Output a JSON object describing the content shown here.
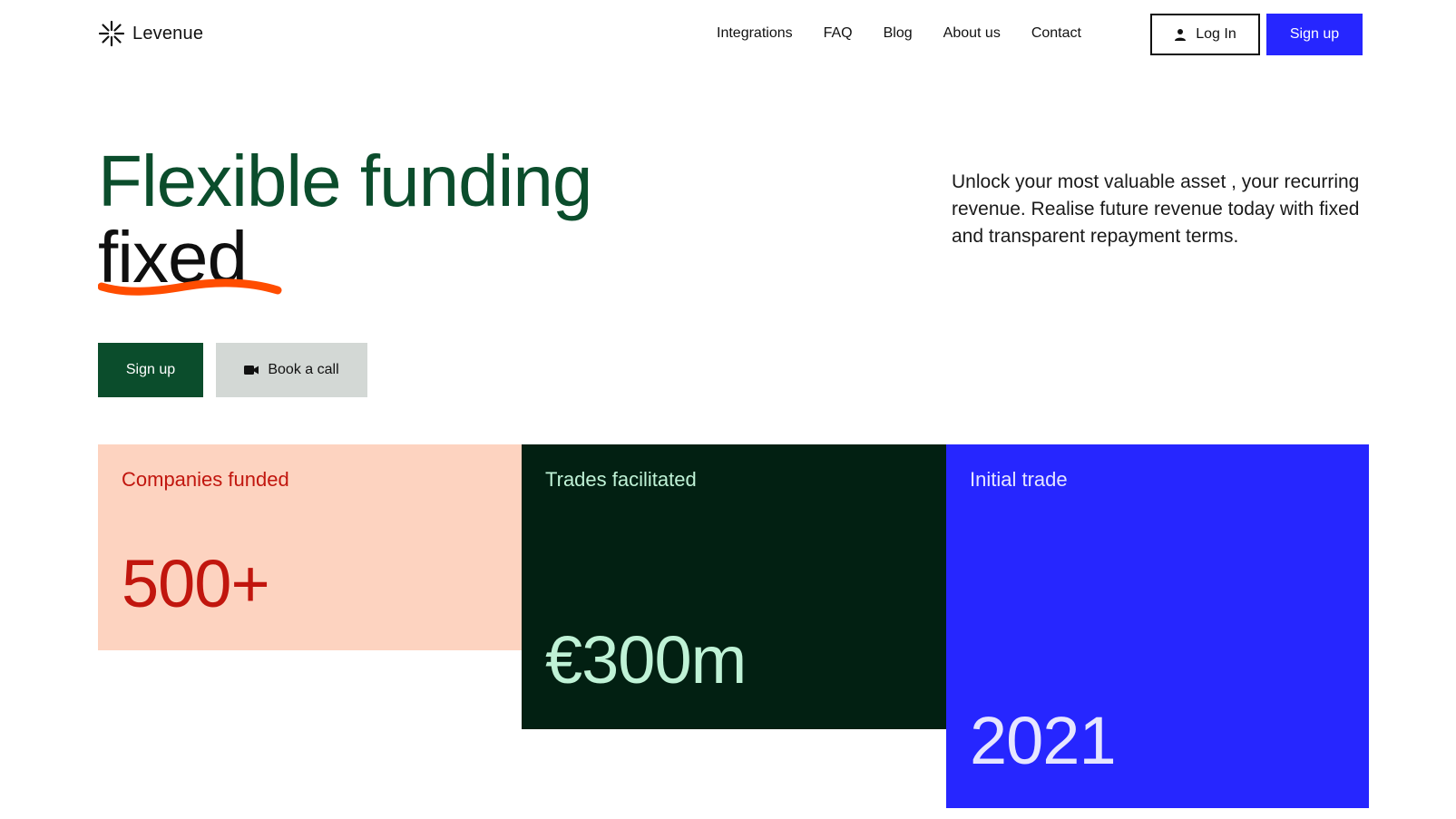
{
  "header": {
    "logo_text": "Levenue",
    "nav": [
      {
        "label": "Integrations"
      },
      {
        "label": "FAQ"
      },
      {
        "label": "Blog"
      },
      {
        "label": "About us"
      },
      {
        "label": "Contact"
      }
    ],
    "login_label": "Log In",
    "signup_label": "Sign up"
  },
  "hero": {
    "title_line1": "Flexible funding",
    "title_line2": "fixed",
    "description": "Unlock your most valuable asset , your recurring revenue. Realise future revenue today with fixed and transparent repayment terms.",
    "signup_label": "Sign up",
    "book_label": "Book a call"
  },
  "stats": [
    {
      "label": "Companies funded",
      "value": "500+"
    },
    {
      "label": "Trades facilitated",
      "value": "€300m"
    },
    {
      "label": "Initial trade",
      "value": "2021"
    }
  ],
  "colors": {
    "brand_green": "#0b4d2c",
    "brand_blue": "#2626ff",
    "accent_orange": "#ff4d00",
    "peach": "#fdd3c0",
    "dark_green": "#022012"
  },
  "icons": {
    "logo": "asterisk-logo-icon",
    "login": "user-icon",
    "book": "video-camera-icon"
  }
}
